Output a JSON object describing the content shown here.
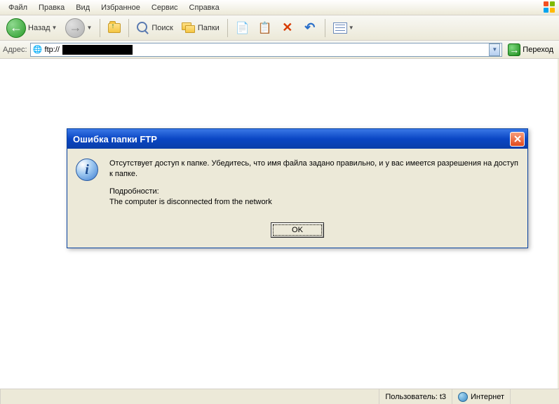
{
  "menubar": {
    "items": [
      "Файл",
      "Правка",
      "Вид",
      "Избранное",
      "Сервис",
      "Справка"
    ]
  },
  "toolbar": {
    "back_label": "Назад",
    "search_label": "Поиск",
    "folders_label": "Папки"
  },
  "addressbar": {
    "label": "Адрес:",
    "value_prefix": "ftp://",
    "go_label": "Переход"
  },
  "dialog": {
    "title": "Ошибка папки FTP",
    "message": "Отсутствует доступ к папке. Убедитесь, что имя файла задано правильно, и у вас имеется разрешения на доступ к папке.",
    "details_label": "Подробности:",
    "details_text": "The computer is disconnected from the network",
    "ok_label": "OK"
  },
  "statusbar": {
    "user": "Пользователь: t3",
    "zone": "Интернет"
  }
}
